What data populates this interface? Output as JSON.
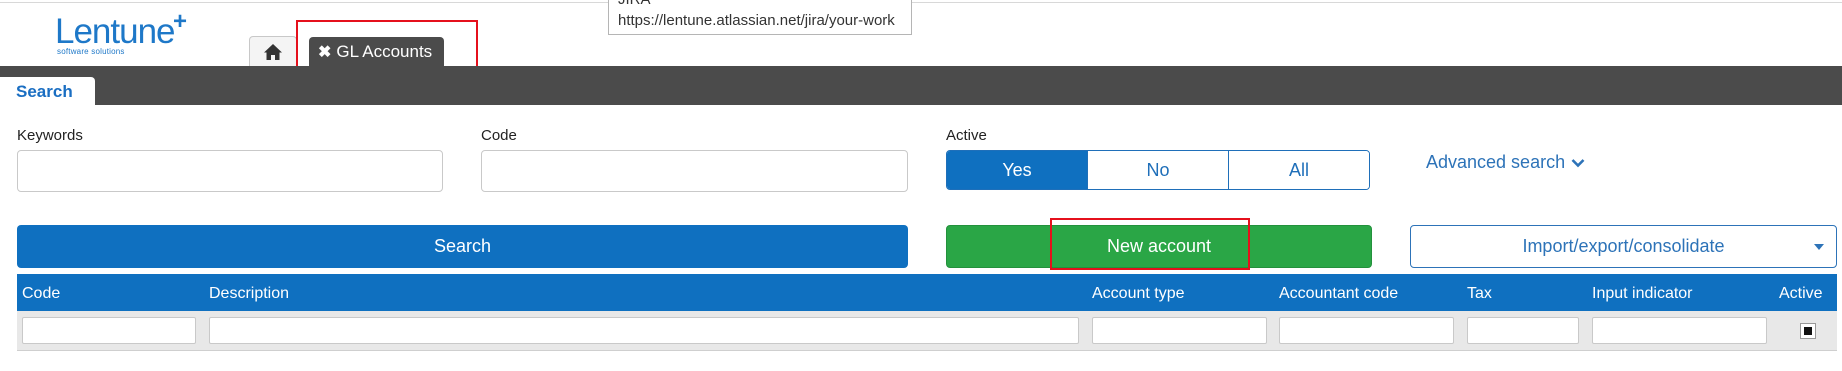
{
  "brand": {
    "name": "Lentune",
    "plus": "+",
    "tagline": "software solutions",
    "color": "#1e78c8"
  },
  "tooltip": {
    "title": "JIRA",
    "url": "https://lentune.atlassian.net/jira/your-work"
  },
  "tabs": {
    "home_icon": "home-icon",
    "active_tab": "GL Accounts",
    "close_icon": "close-icon",
    "close_glyph": "✖"
  },
  "subtab": {
    "label": "Search"
  },
  "filters": {
    "keywords_label": "Keywords",
    "keywords_value": "",
    "code_label": "Code",
    "code_value": "",
    "active_label": "Active",
    "active_options": [
      "Yes",
      "No",
      "All"
    ],
    "active_selected": "Yes",
    "advanced_search": "Advanced search",
    "advanced_icon": "chevron-down-icon"
  },
  "actions": {
    "search": "Search",
    "new_account": "New account",
    "import_export": "Import/export/consolidate"
  },
  "table": {
    "columns": [
      "Code",
      "Description",
      "Account type",
      "Accountant code",
      "Tax",
      "Input indicator",
      "Active"
    ]
  },
  "colors": {
    "primary": "#0f70c0",
    "success": "#2aa646",
    "dark_bar": "#4b4b4b",
    "highlight": "#e5101c"
  }
}
